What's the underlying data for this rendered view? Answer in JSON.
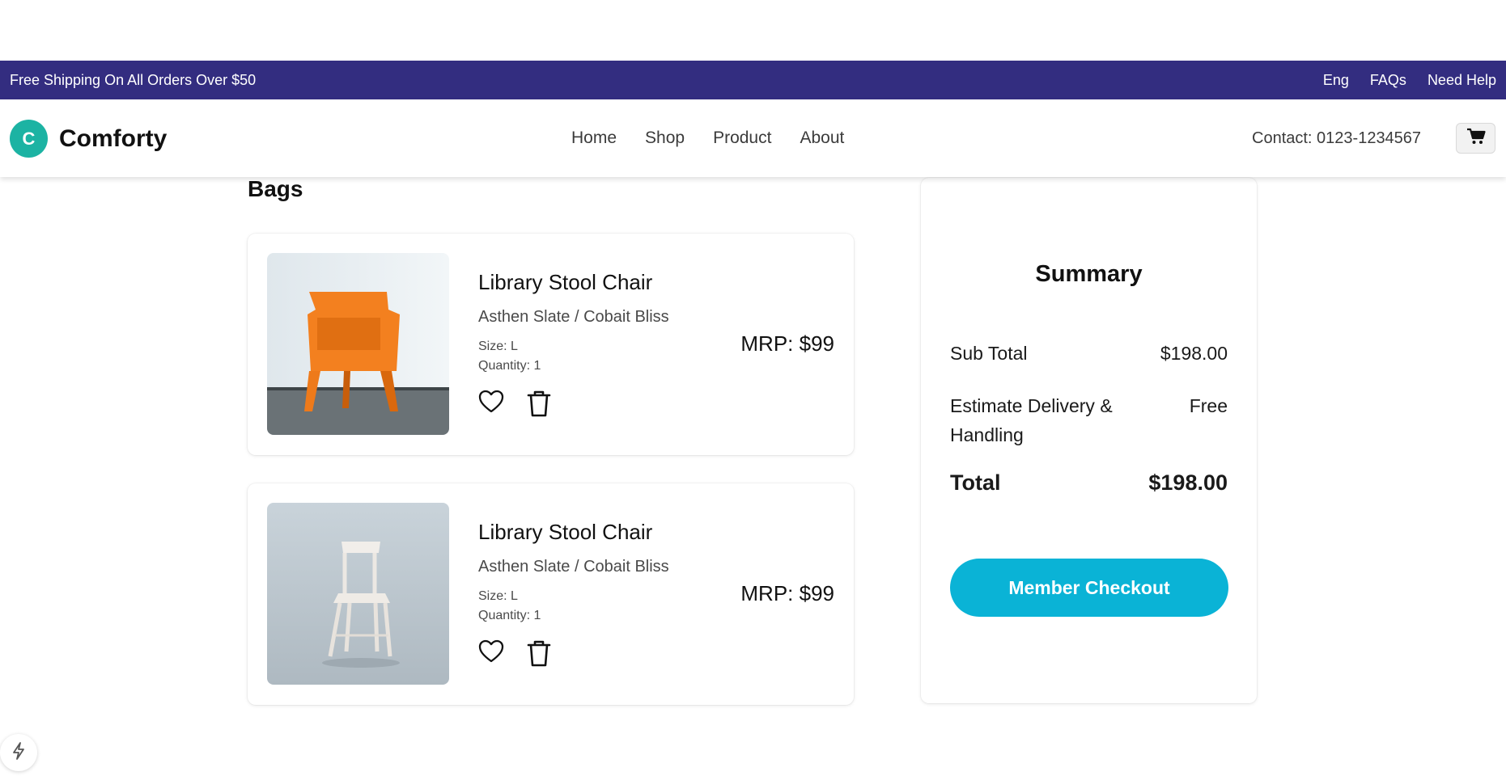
{
  "topbar": {
    "promo": "Free Shipping On All Orders Over $50",
    "links": [
      "Eng",
      "FAQs",
      "Need Help"
    ]
  },
  "header": {
    "logo_letter": "C",
    "brand": "Comforty",
    "nav": [
      "Home",
      "Shop",
      "Product",
      "About"
    ],
    "contact": "Contact: 0123-1234567"
  },
  "bag": {
    "title": "Bags",
    "items": [
      {
        "name": "Library Stool Chair",
        "variant": "Asthen Slate / Cobait Bliss",
        "size": "Size: L",
        "quantity": "Quantity: 1",
        "price": "MRP: $99",
        "image": "orange-chair"
      },
      {
        "name": "Library Stool Chair",
        "variant": "Asthen Slate / Cobait Bliss",
        "size": "Size: L",
        "quantity": "Quantity: 1",
        "price": "MRP: $99",
        "image": "white-chair"
      }
    ]
  },
  "summary": {
    "title": "Summary",
    "subtotal_label": "Sub Total",
    "subtotal_value": "$198.00",
    "delivery_label": "Estimate Delivery & Handling",
    "delivery_value": "Free",
    "total_label": "Total",
    "total_value": "$198.00",
    "checkout_label": "Member Checkout"
  },
  "colors": {
    "topbar": "#332d80",
    "logo": "#1cb3a3",
    "checkout": "#0ab3d6"
  }
}
